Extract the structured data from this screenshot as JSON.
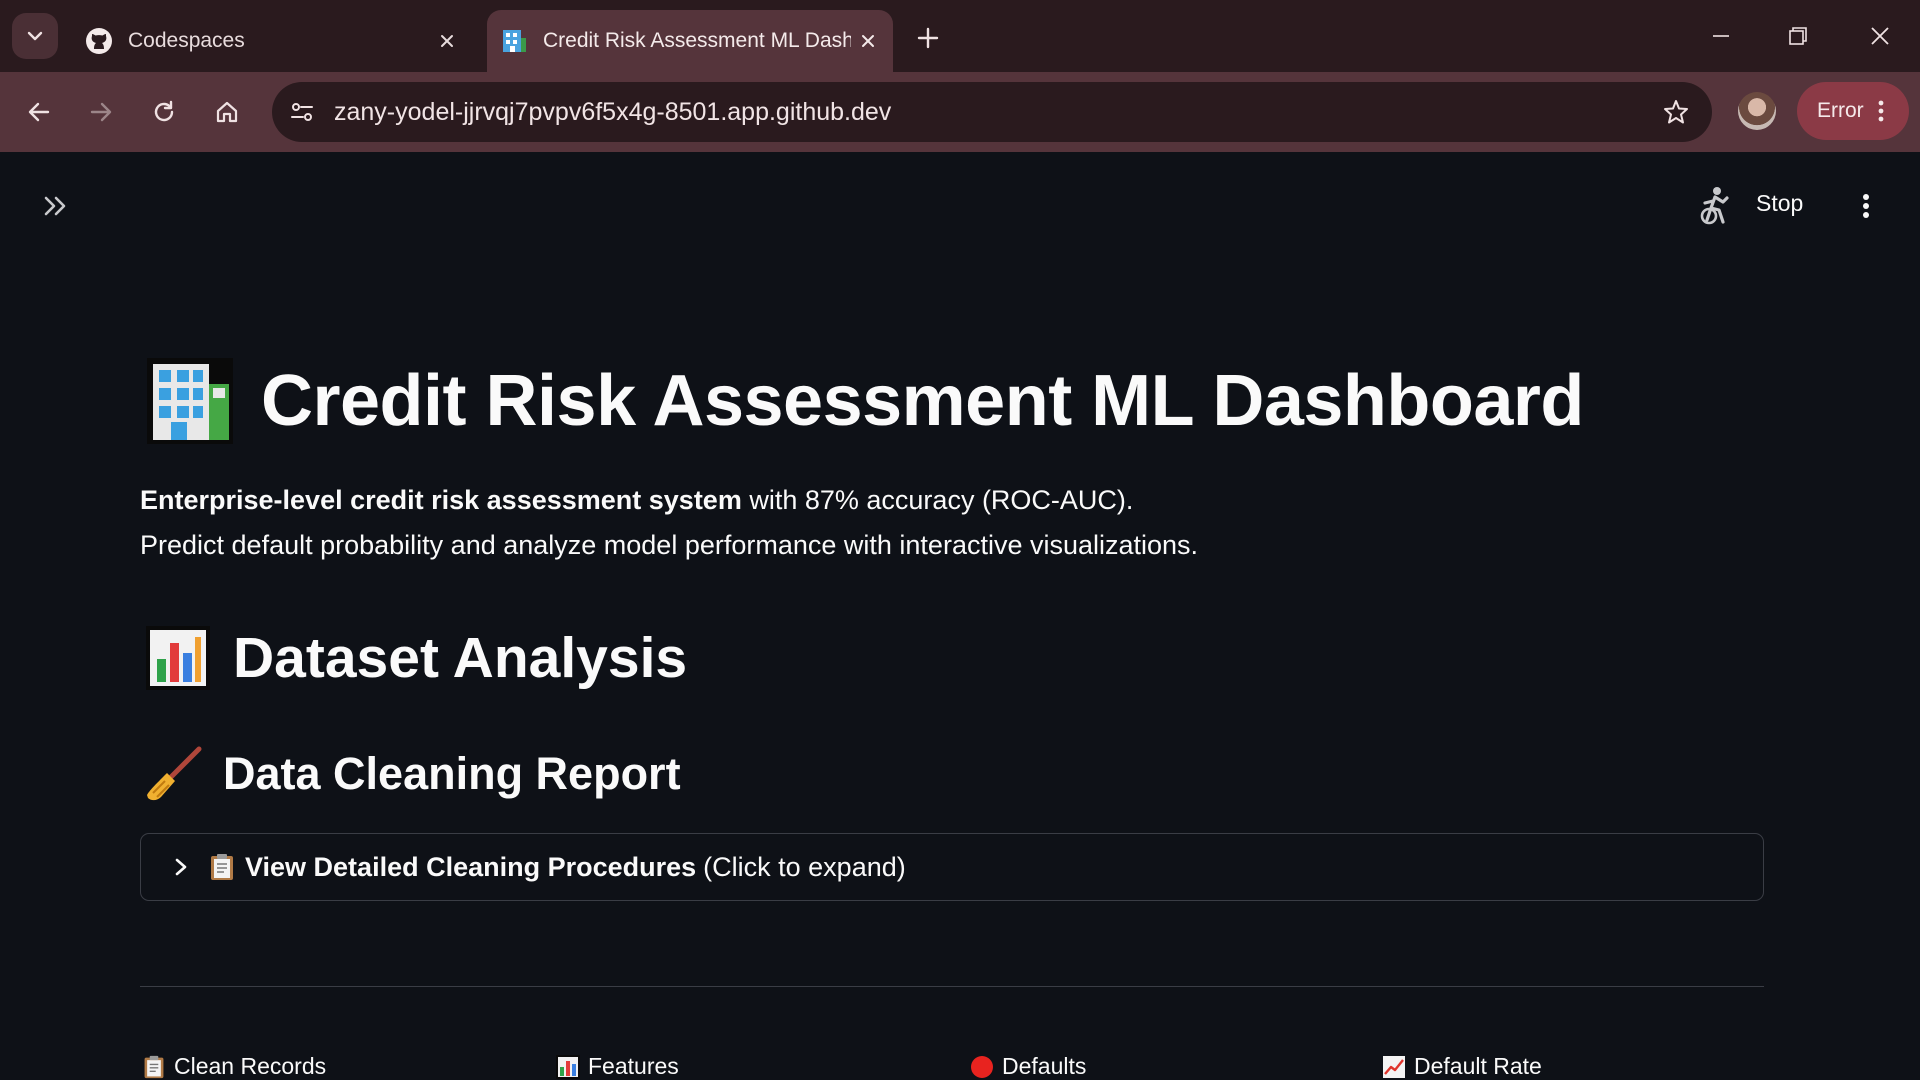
{
  "browser": {
    "tabs": [
      {
        "title": "Codespaces",
        "favicon": "github-icon",
        "active": false
      },
      {
        "title": "Credit Risk Assessment ML Dashboard",
        "favicon": "office-building-icon",
        "active": true
      }
    ],
    "url": "zany-yodel-jjrvqj7pvpv6f5x4g-8501.app.github.dev",
    "profile_status": "Error",
    "colors": {
      "frame": "#2a1a1e",
      "toolbar": "#55343b",
      "error_pill": "#8b3a46"
    }
  },
  "app_header": {
    "stop_label": "Stop"
  },
  "page": {
    "title": "Credit Risk Assessment ML Dashboard",
    "title_icon": "office-building-emoji",
    "intro": {
      "bold_text": "Enterprise-level credit risk assessment system",
      "rest_line1": " with 87% accuracy (ROC-AUC).",
      "line2": "Predict default probability and analyze model performance with interactive visualizations."
    },
    "section_title": "Dataset Analysis",
    "section_icon": "bar-chart-emoji",
    "subsection_title": "Data Cleaning Report",
    "subsection_icon": "broom-emoji",
    "expander": {
      "bold_label": "View Detailed Cleaning Procedures",
      "hint": "(Click to expand)",
      "icon": "clipboard-emoji"
    },
    "metrics": [
      {
        "label": "Clean Records",
        "icon": "clipboard-emoji"
      },
      {
        "label": "Features",
        "icon": "bar-chart-emoji"
      },
      {
        "label": "Defaults",
        "icon": "red-circle-emoji"
      },
      {
        "label": "Default Rate",
        "icon": "chart-increasing-emoji"
      }
    ],
    "colors": {
      "background": "#0e1117",
      "text": "#fafafa",
      "border": "#3a3d45"
    }
  }
}
